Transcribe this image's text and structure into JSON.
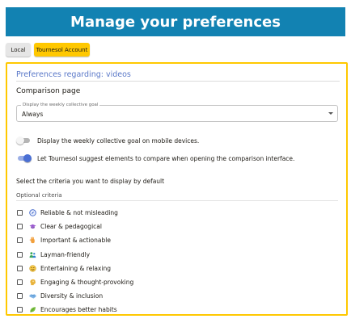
{
  "header": {
    "title": "Manage your preferences"
  },
  "tabs": [
    {
      "label": "Local"
    },
    {
      "label": "Tournesol Account"
    }
  ],
  "section": {
    "title": "Preferences regarding: videos",
    "subheading": "Comparison page"
  },
  "select": {
    "legend": "Display the weekly collective goal",
    "value": "Always"
  },
  "switches": [
    {
      "label": "Display the weekly collective goal on mobile devices.",
      "state": "off"
    },
    {
      "label": "Let Tournesol suggest elements to compare when opening the comparison interface.",
      "state": "on"
    }
  ],
  "criteria": {
    "heading": "Select the criteria you want to display by default",
    "optional_label": "Optional criteria",
    "items": [
      {
        "label": "Reliable & not misleading",
        "icon": "compass-icon"
      },
      {
        "label": "Clear & pedagogical",
        "icon": "graduation-cap-icon"
      },
      {
        "label": "Important & actionable",
        "icon": "raised-hand-icon"
      },
      {
        "label": "Layman-friendly",
        "icon": "people-icon"
      },
      {
        "label": "Entertaining & relaxing",
        "icon": "smiley-icon"
      },
      {
        "label": "Engaging & thought-provoking",
        "icon": "thinking-head-icon"
      },
      {
        "label": "Diversity & inclusion",
        "icon": "handshake-icon"
      },
      {
        "label": "Encourages better habits",
        "icon": "leaf-icon"
      }
    ]
  },
  "colors": {
    "banner": "#1282b2",
    "accent_yellow": "#ffc800",
    "section_title": "#5a78c8",
    "switch_on": "#4a6fd4"
  }
}
